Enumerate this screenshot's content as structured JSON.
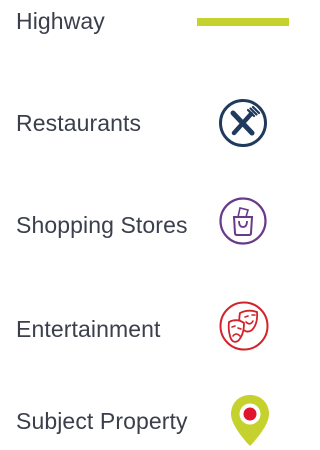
{
  "legend": {
    "items": [
      {
        "label": "Highway",
        "icon": "highway-line",
        "color": "#c5d12c"
      },
      {
        "label": "Restaurants",
        "icon": "fork-knife-icon",
        "color": "#1f3a5c"
      },
      {
        "label": "Shopping Stores",
        "icon": "shopping-bag-icon",
        "color": "#6a3a8a"
      },
      {
        "label": "Entertainment",
        "icon": "theater-masks-icon",
        "color": "#d2232a"
      },
      {
        "label": "Subject Property",
        "icon": "map-pin-icon",
        "color": "#c5d12c",
        "accent": "#e0142b"
      }
    ]
  }
}
